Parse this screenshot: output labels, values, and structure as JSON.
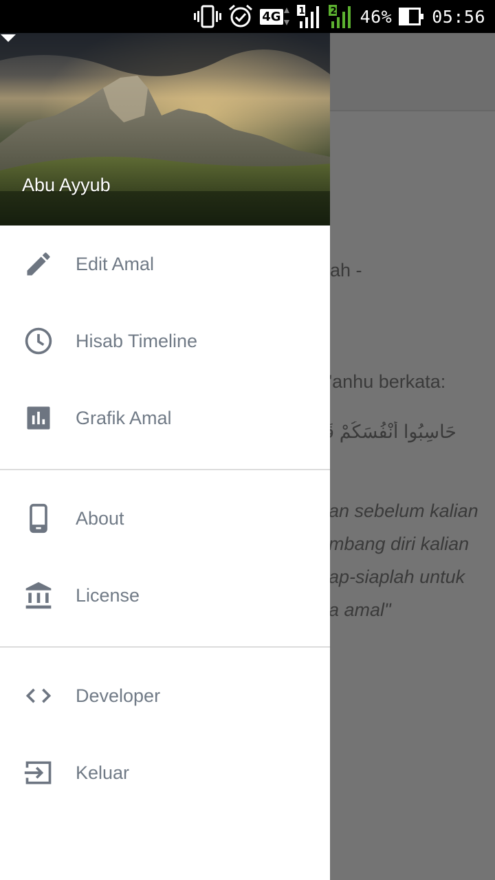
{
  "status_bar": {
    "network_label": "4G",
    "sim1": "1",
    "sim2": "2",
    "battery": "46%",
    "time": "05:56",
    "icons": [
      "vibrate-icon",
      "alarm-icon",
      "lte-icon",
      "signal-sim1-icon",
      "signal-sim2-icon",
      "battery-icon"
    ]
  },
  "behind_content": {
    "line1": "ah -",
    "line2": "'anhu berkata:",
    "arabic": "حَاسِبُوا أَنْفُسَكُمْ قَبْلَ",
    "italic1": "an sebelum kalian",
    "italic2": "mbang diri kalian",
    "italic3": "ap-siaplah untuk",
    "italic4": "a amal\""
  },
  "drawer": {
    "account_name": "Abu Ayyub",
    "menu_items": [
      {
        "label": "Edit Amal",
        "icon": "pencil-icon"
      },
      {
        "label": "Hisab Timeline",
        "icon": "clock-icon"
      },
      {
        "label": "Grafik Amal",
        "icon": "bar-chart-icon"
      },
      {
        "label": "About",
        "icon": "phone-icon"
      },
      {
        "label": "License",
        "icon": "bank-icon"
      },
      {
        "label": "Developer",
        "icon": "code-icon"
      },
      {
        "label": "Keluar",
        "icon": "exit-icon"
      }
    ]
  },
  "colors": {
    "icon": "#6d7581",
    "label": "#707a86",
    "scrim": "#747474"
  }
}
